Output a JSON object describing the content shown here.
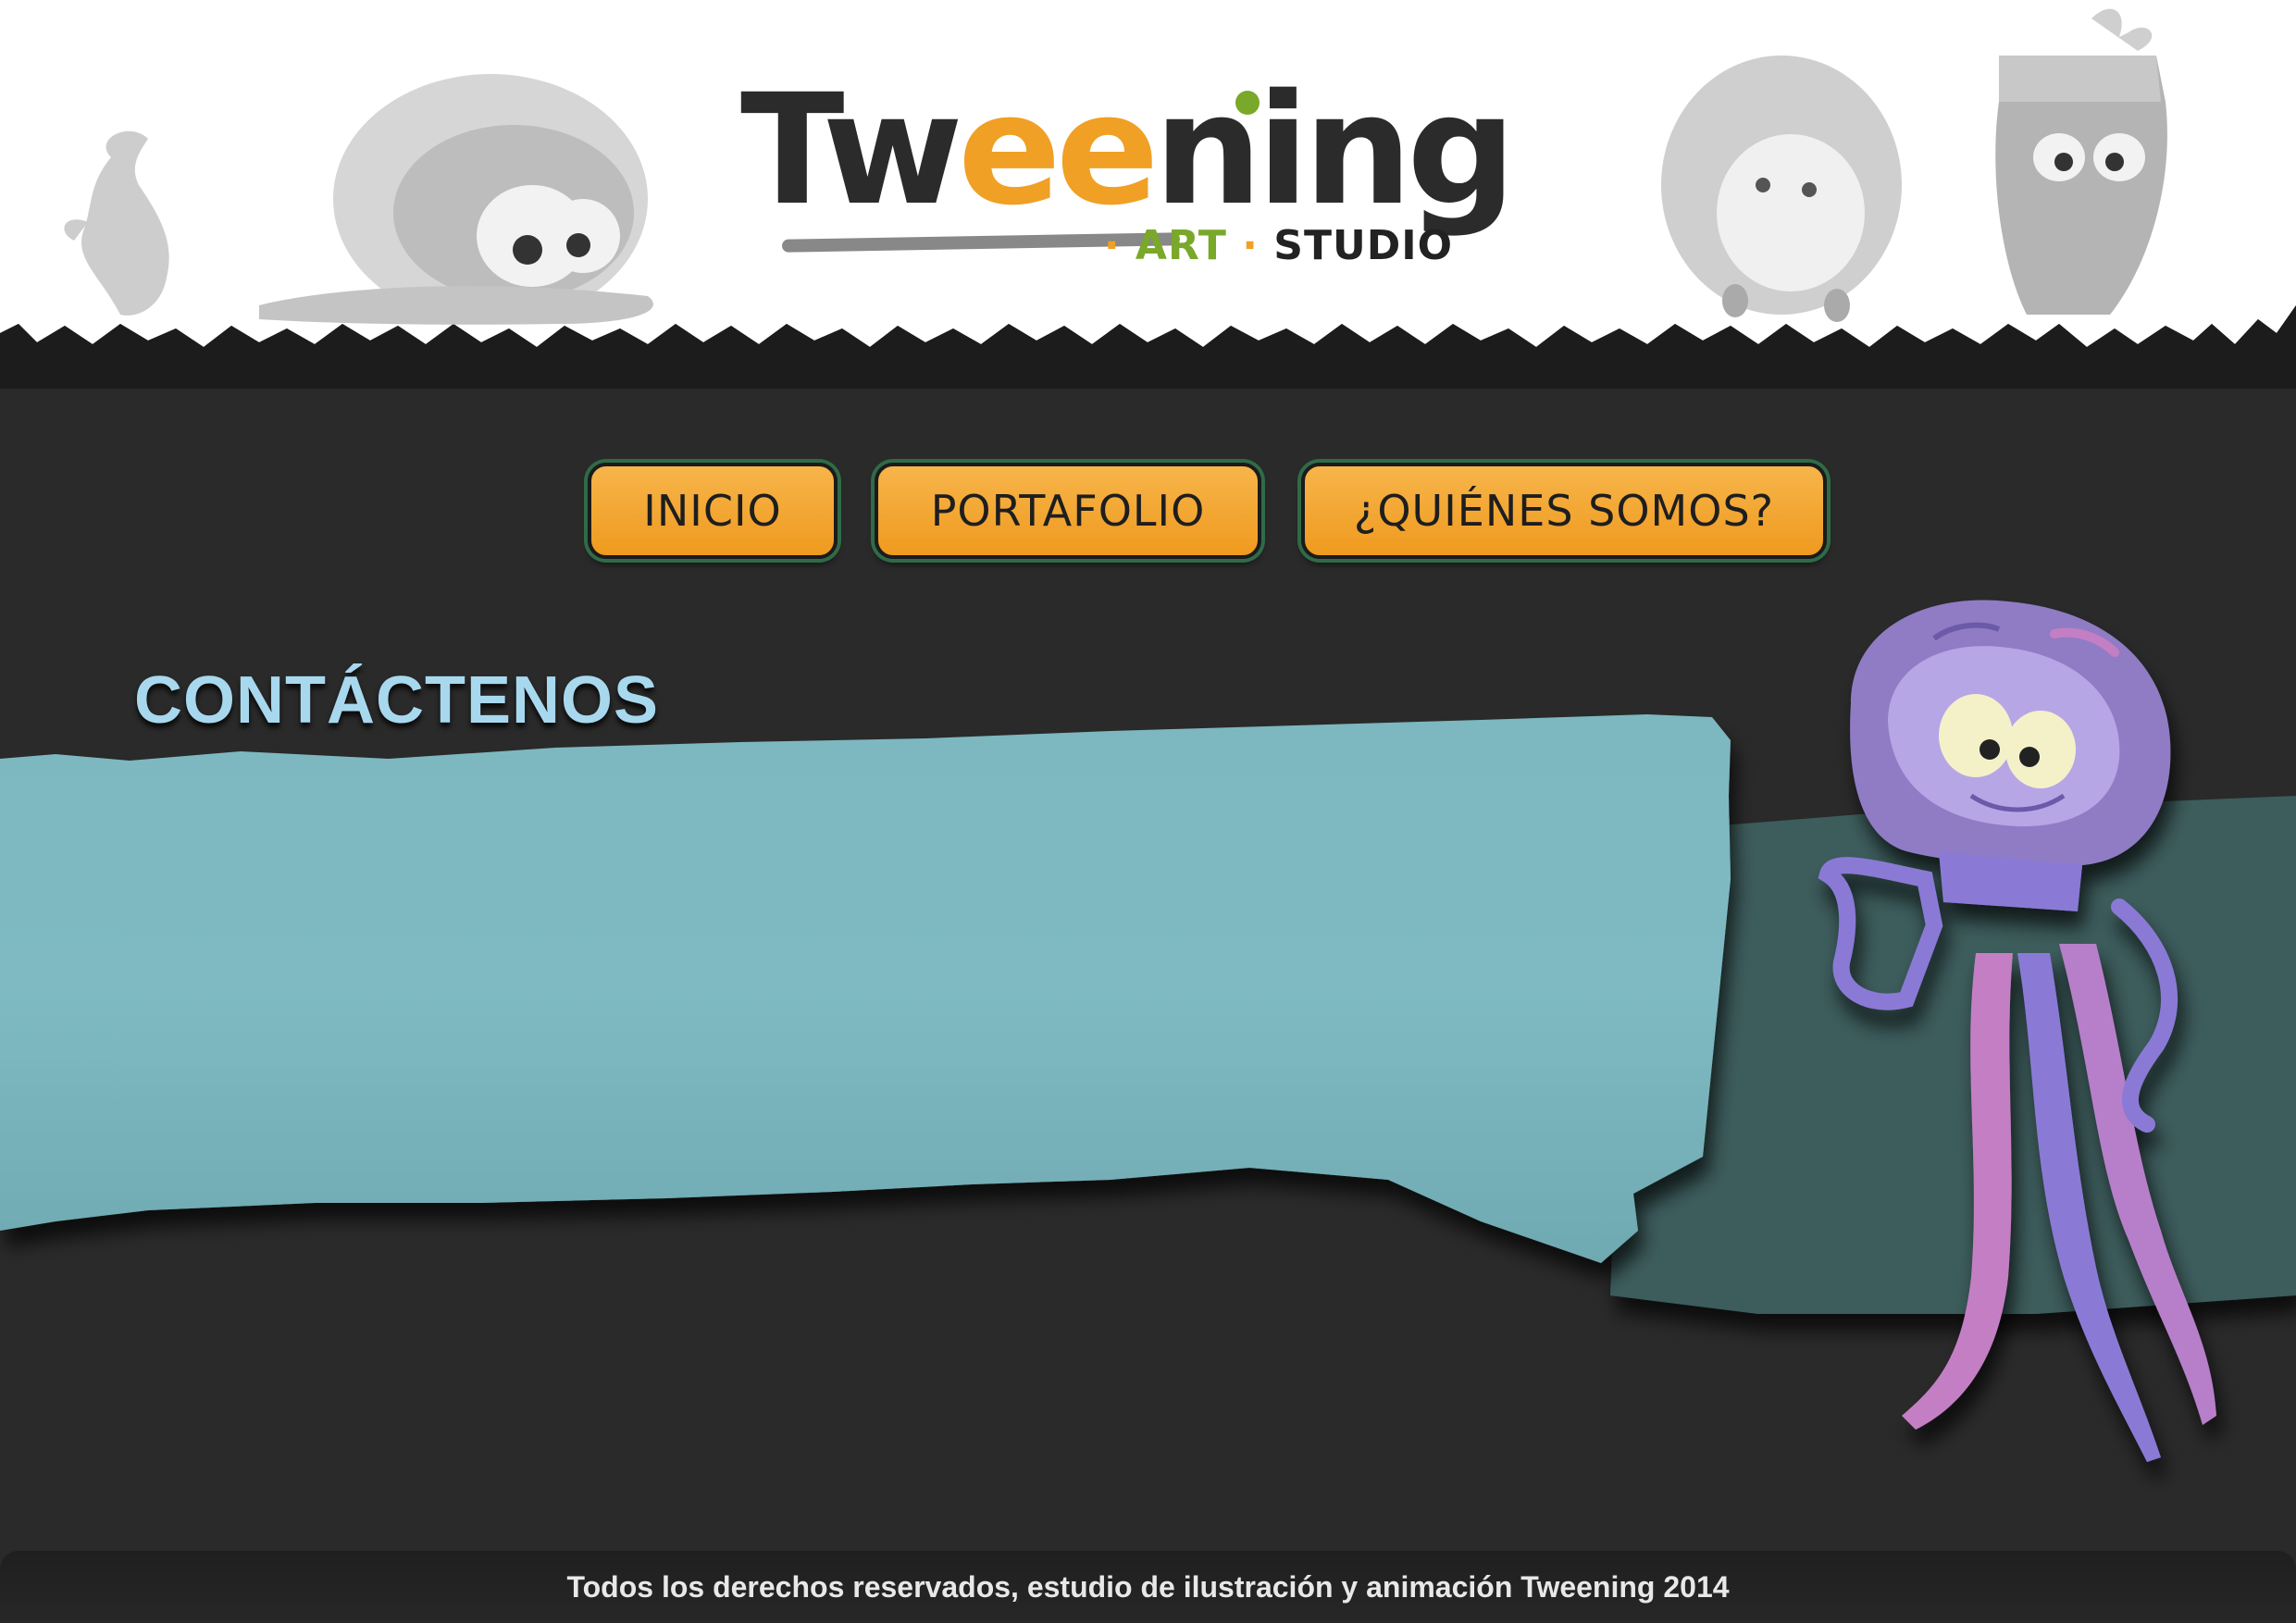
{
  "brand": {
    "name": "Tweening",
    "name_prefix": "Tw",
    "name_e": "ee",
    "name_suffix": "ning",
    "sub_art": "ART",
    "sub_studio": "STUDIO",
    "sub_dot": "·"
  },
  "nav": {
    "items": [
      {
        "label": "INICIO"
      },
      {
        "label": "PORTAFOLIO"
      },
      {
        "label": "¿QUIÉNES SOMOS?"
      }
    ]
  },
  "main": {
    "title": "CONTÁCTENOS"
  },
  "footer": {
    "text": "Todos los derechos reservados, estudio de ilustración y animación Tweening 2014"
  },
  "colors": {
    "background": "#2a2a2a",
    "header": "#ffffff",
    "button": "#f2a22c",
    "title": "#a8d8ee",
    "panel": "#7ab6be",
    "jellyfish": "#8f7cc4"
  },
  "decorations": {
    "header_characters": [
      "ghost-character-illustration",
      "jellyfish-character-illustration",
      "furry-monster-illustration",
      "carrot-character-illustration"
    ],
    "mascot": "purple-jellyfish-mascot"
  }
}
